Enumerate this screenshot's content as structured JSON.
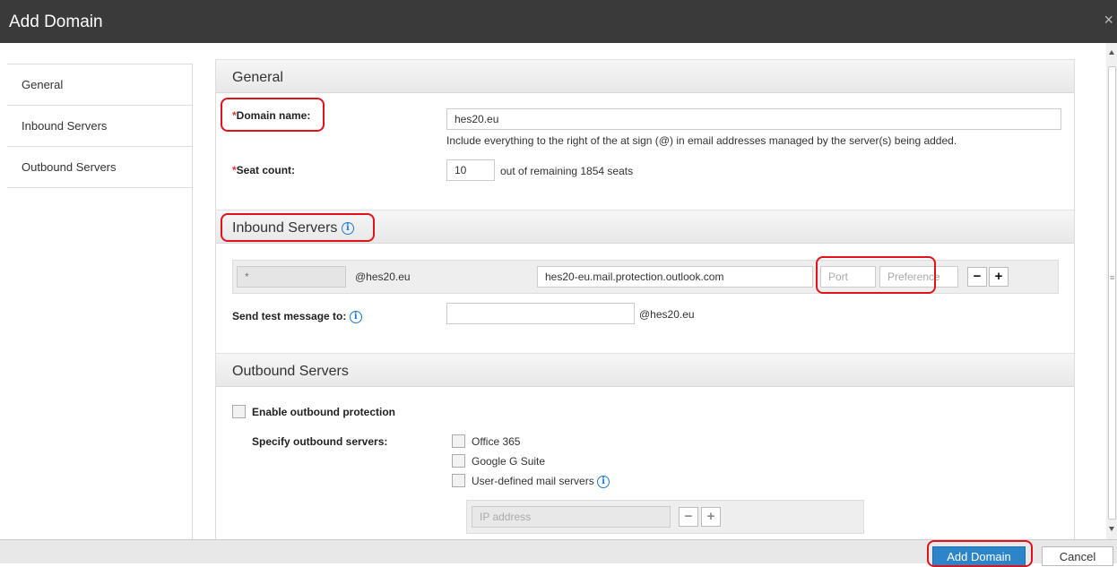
{
  "dialog": {
    "title": "Add Domain",
    "close_glyph": "×"
  },
  "sidebar": {
    "items": [
      {
        "label": "General"
      },
      {
        "label": "Inbound Servers"
      },
      {
        "label": "Outbound Servers"
      }
    ]
  },
  "general": {
    "title": "General",
    "domain_label": "Domain name:",
    "domain_value": "hes20.eu",
    "domain_hint": "Include everything to the right of the at sign (@) in email addresses managed by the server(s) being added.",
    "seat_label": "Seat count:",
    "seat_value": "10",
    "seat_hint": "out of remaining 1854 seats",
    "required_mark": "*"
  },
  "inbound": {
    "title": "Inbound Servers",
    "info_icon": "info-icon",
    "prefix_value": "*",
    "domain_suffix": "@hes20.eu",
    "server_value": "hes20-eu.mail.protection.outlook.com",
    "port_placeholder": "Port",
    "preference_placeholder": "Preference",
    "minus_glyph": "−",
    "plus_glyph": "+",
    "test_label": "Send test message to:",
    "test_suffix": "@hes20.eu"
  },
  "outbound": {
    "title": "Outbound Servers",
    "enable_label": "Enable outbound protection",
    "specify_label": "Specify outbound servers:",
    "options": [
      {
        "label": "Office 365"
      },
      {
        "label": "Google G Suite"
      },
      {
        "label": "User-defined mail servers"
      }
    ],
    "ip_placeholder": "IP address",
    "minus_glyph": "−",
    "plus_glyph": "+"
  },
  "footer": {
    "primary_label": "Add Domain",
    "cancel_label": "Cancel"
  },
  "colors": {
    "titlebar": "#3a3a3a",
    "primary": "#2c85c9",
    "annotation": "#e0121a",
    "info": "#1e7bd3"
  }
}
